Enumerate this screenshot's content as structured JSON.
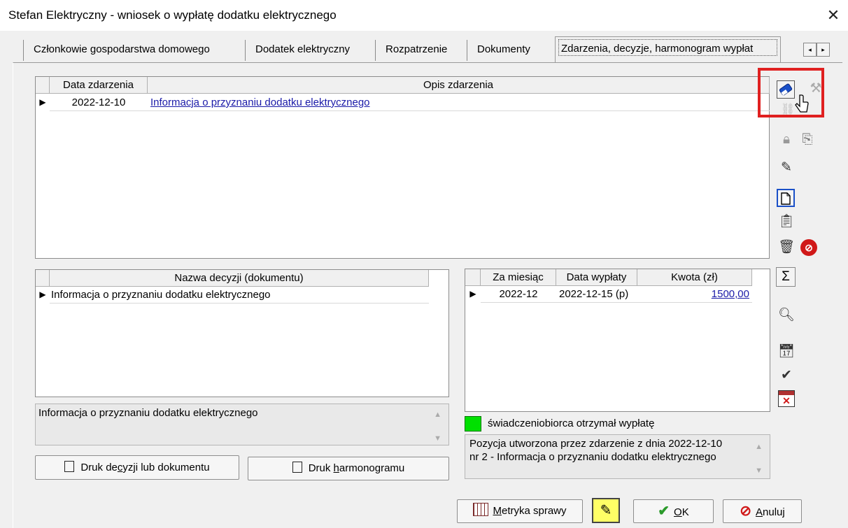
{
  "window": {
    "title": "Stefan Elektryczny - wniosek o wypłatę dodatku elektrycznego",
    "close_glyph": "✕"
  },
  "tabs": [
    {
      "label": "Członkowie gospodarstwa domowego"
    },
    {
      "label": "Dodatek elektryczny"
    },
    {
      "label": "Rozpatrzenie"
    },
    {
      "label": "Dokumenty"
    },
    {
      "label": "Zdarzenia, decyzje, harmonogram wypłat"
    }
  ],
  "tab_scroll": {
    "left": "◂",
    "right": "▸"
  },
  "events_grid": {
    "headers": [
      "Data zdarzenia",
      "Opis zdarzenia"
    ],
    "rows": [
      {
        "date": "2022-12-10",
        "description": "Informacja o przyznaniu dodatku elektrycznego"
      }
    ]
  },
  "decisions_grid": {
    "header": "Nazwa decyzji (dokumentu)",
    "rows": [
      {
        "name": "Informacja o przyznaniu dodatku elektrycznego"
      }
    ],
    "memo": "Informacja o przyznaniu dodatku elektrycznego"
  },
  "schedule_grid": {
    "headers": [
      "Za miesiąc",
      "Data wypłaty",
      "Kwota (zł)"
    ],
    "rows": [
      {
        "month": "2022-12",
        "payment_date": "2022-12-15 (p)",
        "amount": "1500,00"
      }
    ],
    "legend": "świadczeniobiorca otrzymał wypłatę",
    "legend_color": "#00e000",
    "memo_line1": "Pozycja utworzona przez zdarzenie z dnia 2022-12-10",
    "memo_line2": "nr 2 - Informacja o przyznaniu dodatku elektrycznego"
  },
  "buttons": {
    "print_decision_pre": "Druk de",
    "print_decision_u": "c",
    "print_decision_post": "yzji lub dokumentu",
    "print_schedule_pre": "Druk ",
    "print_schedule_u": "h",
    "print_schedule_post": "armonogramu",
    "metric_u": "M",
    "metric_post": "etryka sprawy",
    "ok_u": "O",
    "ok_post": "K",
    "cancel_u": "A",
    "cancel_post": "nuluj"
  },
  "icons": {
    "sigma": "Σ"
  },
  "colors": {
    "highlight": "#e02020",
    "accent_blue": "#1a50c8",
    "link": "#1a1aa8",
    "check_green": "#2a9a2a",
    "stop_red": "#d01818"
  }
}
